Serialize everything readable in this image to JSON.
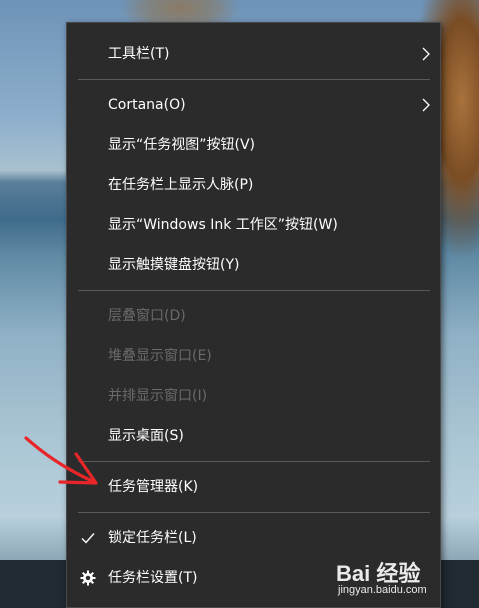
{
  "context_menu": {
    "items": [
      {
        "label": "工具栏(T)",
        "enabled": true,
        "submenu": true
      },
      {
        "label": "Cortana(O)",
        "enabled": true,
        "submenu": true
      },
      {
        "label": "显示“任务视图”按钮(V)",
        "enabled": true
      },
      {
        "label": "在任务栏上显示人脉(P)",
        "enabled": true
      },
      {
        "label": "显示“Windows Ink 工作区”按钮(W)",
        "enabled": true
      },
      {
        "label": "显示触摸键盘按钮(Y)",
        "enabled": true
      },
      {
        "label": "层叠窗口(D)",
        "enabled": false
      },
      {
        "label": "堆叠显示窗口(E)",
        "enabled": false
      },
      {
        "label": "并排显示窗口(I)",
        "enabled": false
      },
      {
        "label": "显示桌面(S)",
        "enabled": true
      },
      {
        "label": "任务管理器(K)",
        "enabled": true
      },
      {
        "label": "锁定任务栏(L)",
        "enabled": true,
        "checked": true,
        "icon": "checkmark-icon"
      },
      {
        "label": "任务栏设置(T)",
        "enabled": true,
        "icon": "gear-icon"
      }
    ]
  },
  "annotation": {
    "icon": "red-arrow-icon",
    "color": "#e8262a"
  },
  "watermark": {
    "main": "Bai 经验",
    "sub": "jingyan.baidu.com"
  },
  "colors": {
    "menu_bg": "#2b2b2b",
    "text": "#ffffff",
    "disabled_text": "#6a6a6a",
    "separator": "#5a5a5a"
  }
}
